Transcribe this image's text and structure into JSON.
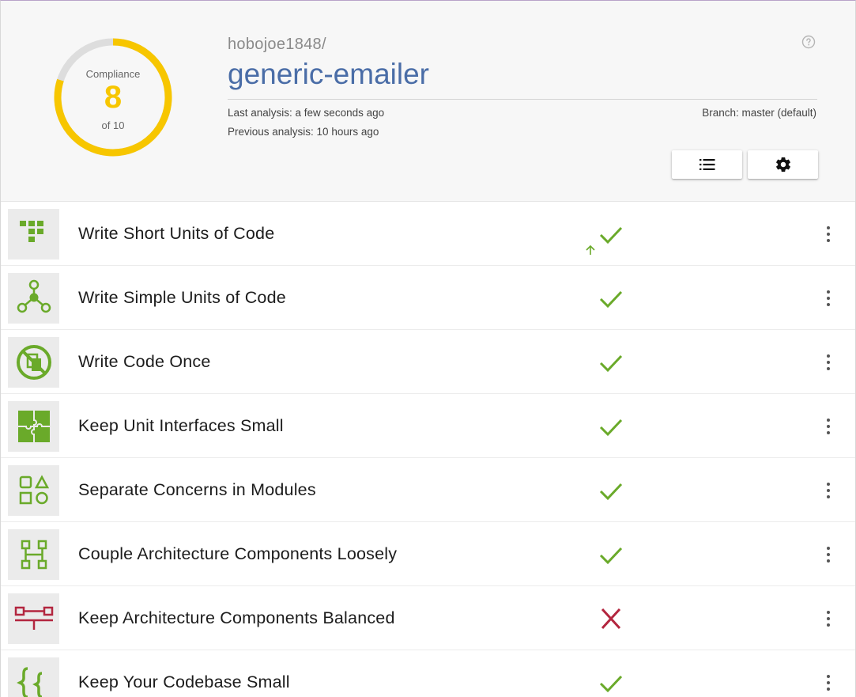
{
  "header": {
    "owner": "hobojoe1848/",
    "repo": "generic-emailer",
    "last_analysis": "Last analysis: a few seconds ago",
    "previous_analysis": "Previous analysis: 10 hours ago",
    "branch": "Branch: master (default)",
    "help_icon": "help-circle-icon",
    "list_button_icon": "list-icon",
    "settings_button_icon": "gear-icon"
  },
  "compliance": {
    "label": "Compliance",
    "score": "8",
    "of": "of 10",
    "fraction": 0.8,
    "color": "#f7c600",
    "track_color": "#dddddd"
  },
  "colors": {
    "pass": "#6aaa2a",
    "fail": "#b3263f",
    "repo_link": "#4a6da7"
  },
  "guidelines": [
    {
      "label": "Write Short Units of Code",
      "icon": "short-units-icon",
      "status": "pass",
      "trend": "up-arrow-icon"
    },
    {
      "label": "Write Simple Units of Code",
      "icon": "simple-units-icon",
      "status": "pass"
    },
    {
      "label": "Write Code Once",
      "icon": "no-duplication-icon",
      "status": "pass"
    },
    {
      "label": "Keep Unit Interfaces Small",
      "icon": "puzzle-icon",
      "status": "pass"
    },
    {
      "label": "Separate Concerns in Modules",
      "icon": "modules-icon",
      "status": "pass"
    },
    {
      "label": "Couple Architecture Components Loosely",
      "icon": "components-icon",
      "status": "pass"
    },
    {
      "label": "Keep Architecture Components Balanced",
      "icon": "balance-icon",
      "status": "fail"
    },
    {
      "label": "Keep Your Codebase Small",
      "icon": "braces-icon",
      "status": "pass"
    }
  ]
}
